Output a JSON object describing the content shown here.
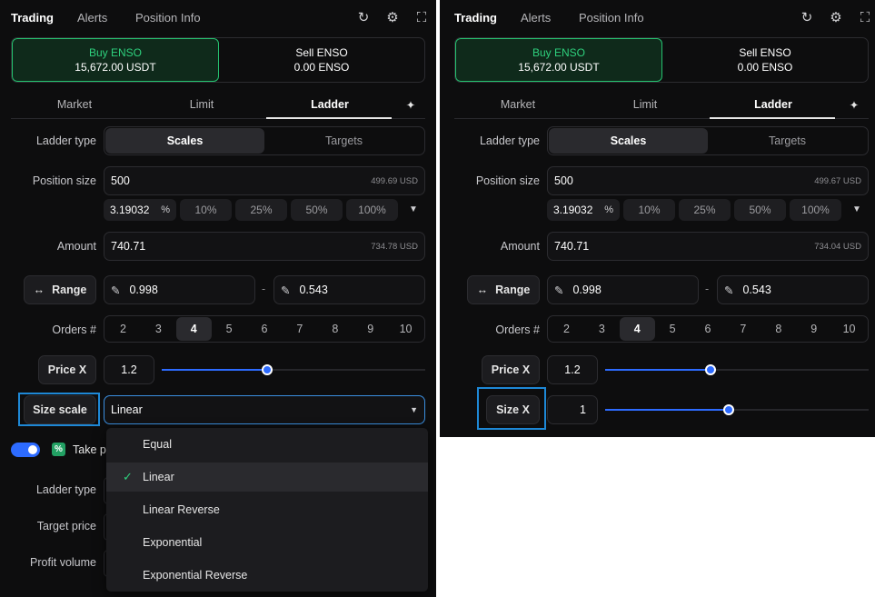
{
  "colors": {
    "panel_bg": "#0d0d0e",
    "buy_green": "#2ed07d",
    "accent_blue": "#2d6bff",
    "highlight_blue": "#1e88d6",
    "check_green": "#2ed07d"
  },
  "left": {
    "tabs": [
      "Trading",
      "Alerts",
      "Position Info"
    ],
    "header_icons": [
      "refresh-icon",
      "gear-icon",
      "fullscreen-icon"
    ],
    "buy": {
      "title": "Buy ENSO",
      "amount": "15,672.00 USDT"
    },
    "sell": {
      "title": "Sell ENSO",
      "amount": "0.00 ENSO"
    },
    "order_types": [
      "Market",
      "Limit",
      "Ladder"
    ],
    "ladder_type": {
      "label": "Ladder type",
      "options": [
        "Scales",
        "Targets"
      ],
      "selected": "Scales"
    },
    "position_size": {
      "label": "Position size",
      "value": "500",
      "hint": "499.69 USD"
    },
    "pct": {
      "value": "3.19032",
      "icon": "percent-icon",
      "options": [
        "10%",
        "25%",
        "50%",
        "100%"
      ]
    },
    "amount": {
      "label": "Amount",
      "value": "740.71",
      "hint": "734.78 USD"
    },
    "range": {
      "button": "Range",
      "from": "0.998",
      "separator": "-",
      "to": "0.543"
    },
    "orders": {
      "label": "Orders #",
      "options": [
        "2",
        "3",
        "4",
        "5",
        "6",
        "7",
        "8",
        "9",
        "10"
      ],
      "selected": "4"
    },
    "price_x": {
      "button": "Price X",
      "value": "1.2",
      "slider_fraction": 0.4
    },
    "size_scale": {
      "button": "Size scale",
      "value": "Linear"
    },
    "take_profit": {
      "label": "Take pr"
    },
    "dropdown": {
      "options": [
        "Equal",
        "Linear",
        "Linear Reverse",
        "Exponential",
        "Exponential Reverse"
      ],
      "selected": "Linear"
    },
    "hidden_labels": [
      "Ladder type",
      "Target price",
      "Profit volume"
    ]
  },
  "right": {
    "tabs": [
      "Trading",
      "Alerts",
      "Position Info"
    ],
    "header_icons": [
      "refresh-icon",
      "gear-icon",
      "fullscreen-icon"
    ],
    "buy": {
      "title": "Buy ENSO",
      "amount": "15,672.00 USDT"
    },
    "sell": {
      "title": "Sell ENSO",
      "amount": "0.00 ENSO"
    },
    "order_types": [
      "Market",
      "Limit",
      "Ladder"
    ],
    "ladder_type": {
      "label": "Ladder type",
      "options": [
        "Scales",
        "Targets"
      ],
      "selected": "Scales"
    },
    "position_size": {
      "label": "Position size",
      "value": "500",
      "hint": "499.67 USD"
    },
    "pct": {
      "value": "3.19032",
      "icon": "percent-icon",
      "options": [
        "10%",
        "25%",
        "50%",
        "100%"
      ]
    },
    "amount": {
      "label": "Amount",
      "value": "740.71",
      "hint": "734.04 USD"
    },
    "range": {
      "button": "Range",
      "from": "0.998",
      "separator": "-",
      "to": "0.543"
    },
    "orders": {
      "label": "Orders #",
      "options": [
        "2",
        "3",
        "4",
        "5",
        "6",
        "7",
        "8",
        "9",
        "10"
      ],
      "selected": "4"
    },
    "price_x": {
      "button": "Price X",
      "value": "1.2",
      "slider_fraction": 0.4
    },
    "size_x": {
      "button": "Size X",
      "value": "1",
      "slider_fraction": 0.47
    }
  }
}
